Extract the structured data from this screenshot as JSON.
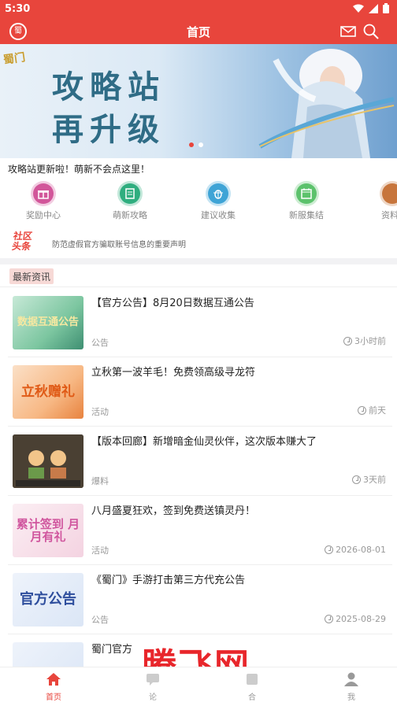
{
  "status_bar": {
    "time": "5:30"
  },
  "app_bar": {
    "title": "首页",
    "logo_text": "蜀"
  },
  "banner": {
    "logo_text": "蜀门",
    "line1": "攻略站",
    "line2": "再升级",
    "page_count": 2,
    "active_page": 1
  },
  "notice": {
    "text": "攻略站更新啦！萌新不会点这里！"
  },
  "quick_links": [
    {
      "label": "奖励中心",
      "icon": "gift-icon",
      "color": "#d2569a"
    },
    {
      "label": "萌新攻略",
      "icon": "guide-icon",
      "color": "#2fae7f"
    },
    {
      "label": "建议收集",
      "icon": "bug-icon",
      "color": "#3fa4d6"
    },
    {
      "label": "新服集结",
      "icon": "calendar-icon",
      "color": "#5cc26c"
    },
    {
      "label": "资料",
      "icon": "archive-icon",
      "color": "#c7753c"
    }
  ],
  "headline": {
    "badge_line1": "社区",
    "badge_line2": "头条",
    "text": "防范虚假官方骗取账号信息的重要声明"
  },
  "section": {
    "title": "最新资讯"
  },
  "news": [
    {
      "title": "【官方公告】8月20日数据互通公告",
      "tag": "公告",
      "time": "3小时前",
      "thumb_text": "数据互通公告"
    },
    {
      "title": "立秋第一波羊毛！免费领高级寻龙符",
      "tag": "活动",
      "time": "前天",
      "thumb_text": "立秋赠礼"
    },
    {
      "title": "【版本回廊】新增暗金仙灵伙伴，这次版本赚大了",
      "tag": "爆料",
      "time": "3天前",
      "thumb_text": ""
    },
    {
      "title": "八月盛夏狂欢，签到免费送镇灵丹！",
      "tag": "活动",
      "time": "2026-08-01",
      "thumb_text": "累计签到 月月有礼"
    },
    {
      "title": "《蜀门》手游打击第三方代充公告",
      "tag": "公告",
      "time": "2025-08-29",
      "thumb_text": "官方公告"
    },
    {
      "title": "蜀门官方",
      "tag": "",
      "time": "",
      "thumb_text": ""
    }
  ],
  "watermark": {
    "text": "腾飞网"
  },
  "bottom_nav": [
    {
      "label": "首页",
      "icon": "home-icon",
      "active": true
    },
    {
      "label": "论",
      "icon": "forum-icon",
      "active": false
    },
    {
      "label": "合",
      "icon": "collection-icon",
      "active": false
    },
    {
      "label": "我",
      "icon": "user-icon",
      "active": false
    }
  ]
}
